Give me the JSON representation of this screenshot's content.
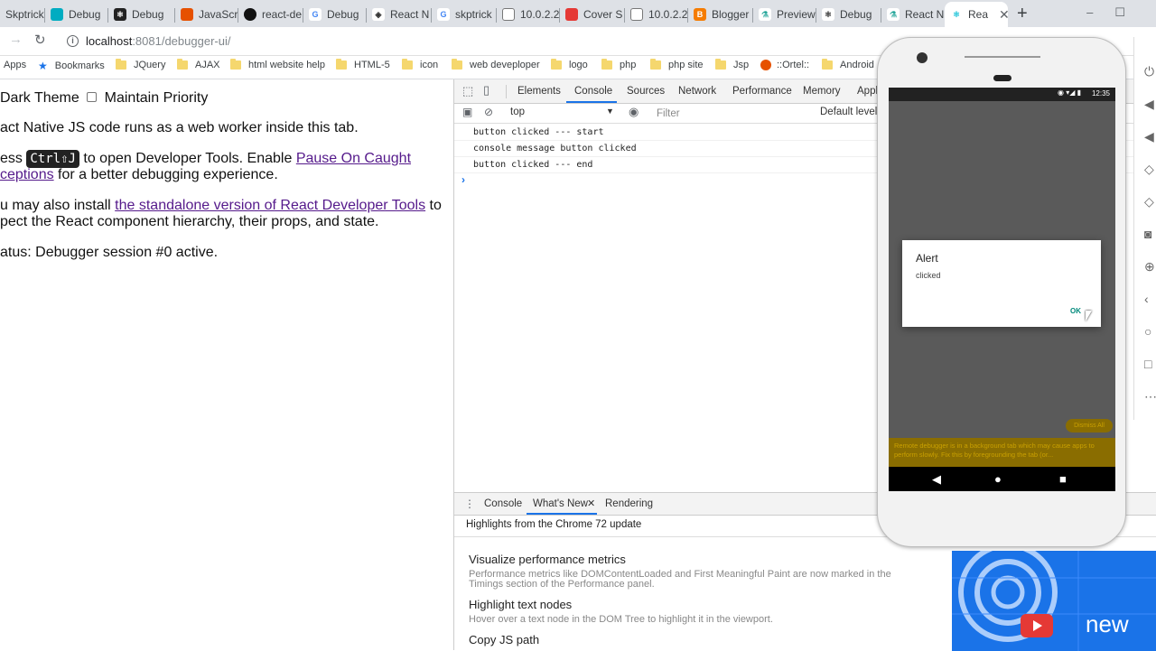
{
  "browser": {
    "tabs": [
      {
        "label": "Skptrick",
        "color": "#ffffff"
      },
      {
        "label": "Debug",
        "color": "#00acc1"
      },
      {
        "label": "Debug",
        "color": "#222222"
      },
      {
        "label": "JavaScri",
        "color": "#e65100"
      },
      {
        "label": "react-de",
        "color": "#111111"
      },
      {
        "label": "Debug",
        "color": "#4285f4"
      },
      {
        "label": "React N",
        "color": "#333333"
      },
      {
        "label": "skptrick",
        "color": "#4285f4"
      },
      {
        "label": "10.0.2.2",
        "color": "#9e9e9e"
      },
      {
        "label": "Cover S",
        "color": "#e53935"
      },
      {
        "label": "10.0.2.2",
        "color": "#9e9e9e"
      },
      {
        "label": "Blogger",
        "color": "#f57c00"
      },
      {
        "label": "Preview",
        "color": "#26a69a"
      },
      {
        "label": "Debug",
        "color": "#333333"
      },
      {
        "label": "React N",
        "color": "#26a69a"
      },
      {
        "label": "Rea",
        "color": "#26c6da"
      }
    ],
    "new_tab": "+",
    "url_host": "localhost",
    "url_path": ":8081/debugger-ui/"
  },
  "bookmarks": {
    "apps": "Apps",
    "items": [
      "Bookmarks",
      "JQuery",
      "AJAX",
      "html website help",
      "HTML-5",
      "icon",
      "web deveploper",
      "logo",
      "php",
      "php site",
      "Jsp",
      "::Ortel::",
      "Android"
    ]
  },
  "page": {
    "theme_label": "Dark Theme",
    "priority_label": "Maintain Priority",
    "line1": "act Native JS code runs as a web worker inside this tab.",
    "press_prefix": "ess",
    "kbd": "Ctrl⇧J",
    "press_mid": " to open Developer Tools. Enable ",
    "pause_link": "Pause On Caught",
    "exceptions_link": "ceptions",
    "press_suffix": " for a better debugging experience.",
    "install_prefix": "u may also install ",
    "standalone_link": "the standalone version of React Developer Tools",
    "install_suffix": " to",
    "inspect_line": "pect the React component hierarchy, their props, and state.",
    "status": "atus: Debugger session #0 active."
  },
  "devtools": {
    "tabs": [
      "Elements",
      "Console",
      "Sources",
      "Network",
      "Performance",
      "Memory",
      "Appli"
    ],
    "active_tab": "Console",
    "context": "top",
    "filter_placeholder": "Filter",
    "levels": "Default levels",
    "console_lines": [
      "button clicked --- start",
      "console message button clicked",
      "button clicked --- end"
    ],
    "drawer_tabs": [
      "Console",
      "What's New",
      "Rendering"
    ],
    "drawer_active": "What's New",
    "highlights": "Highlights from the Chrome 72 update",
    "whats_new": [
      {
        "title": "Visualize performance metrics",
        "desc": "Performance metrics like DOMContentLoaded and First Meaningful Paint are now marked in the Timings section of the Performance panel."
      },
      {
        "title": "Highlight text nodes",
        "desc": "Hover over a text node in the DOM Tree to highlight it in the viewport."
      },
      {
        "title": "Copy JS path",
        "desc": ""
      }
    ],
    "promo_text": "new"
  },
  "emulator": {
    "time": "12:35",
    "alert_title": "Alert",
    "alert_message": "clicked",
    "alert_ok": "OK",
    "dismiss": "Dismiss All",
    "warning": "Remote debugger is in a background tab which may cause apps to perform slowly. Fix this by foregrounding the tab (or..."
  }
}
